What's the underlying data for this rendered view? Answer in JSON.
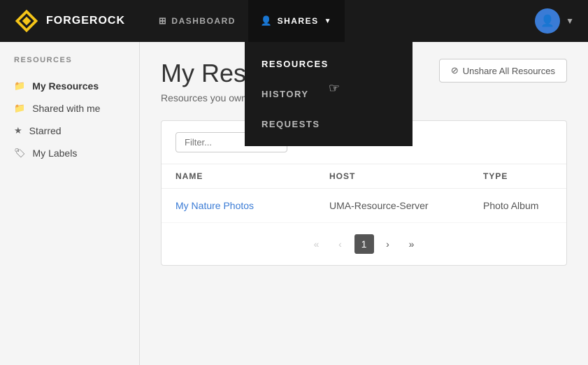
{
  "header": {
    "logo_text": "FORGEROCK",
    "nav_items": [
      {
        "id": "dashboard",
        "label": "DASHBOARD",
        "icon": "⊞",
        "active": false
      },
      {
        "id": "shares",
        "label": "SHARES",
        "icon": "👤",
        "active": true,
        "has_dropdown": true
      }
    ],
    "dropdown_items": [
      {
        "id": "resources",
        "label": "RESOURCES",
        "active": true
      },
      {
        "id": "history",
        "label": "HISTORY",
        "active": false
      },
      {
        "id": "requests",
        "label": "REQUESTS",
        "active": false
      }
    ]
  },
  "sidebar": {
    "section_title": "RESOURCES",
    "items": [
      {
        "id": "my-resources",
        "label": "My Resources",
        "icon": "📁",
        "active": true
      },
      {
        "id": "shared-with-me",
        "label": "Shared with me",
        "icon": "📁",
        "active": false
      },
      {
        "id": "starred",
        "label": "Starred",
        "icon": "★",
        "active": false
      },
      {
        "id": "my-labels",
        "label": "My Labels",
        "icon": "🏷",
        "active": false
      }
    ]
  },
  "main": {
    "page_title": "My Resources",
    "page_subtitle": "Resources you own.",
    "unshare_button": "Unshare All Resources",
    "filter_placeholder": "Filter...",
    "table": {
      "columns": [
        {
          "id": "name",
          "label": "NAME"
        },
        {
          "id": "host",
          "label": "HOST"
        },
        {
          "id": "type",
          "label": "TYPE"
        },
        {
          "id": "action",
          "label": ""
        }
      ],
      "rows": [
        {
          "name": "My Nature Photos",
          "host": "UMA-Resource-Server",
          "type": "Photo Album"
        }
      ]
    },
    "pagination": {
      "first": "«",
      "prev": "‹",
      "current": "1",
      "next": "›",
      "last": "»"
    }
  },
  "cursor_icon": "☞"
}
